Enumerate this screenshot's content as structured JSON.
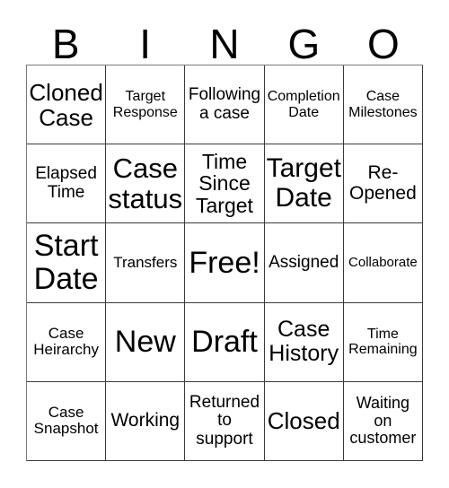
{
  "card": {
    "header_letters": [
      "B",
      "I",
      "N",
      "G",
      "O"
    ],
    "columns": 5,
    "rows": 5,
    "free_space_label": "Free!",
    "free_space_position": {
      "row": 3,
      "column": 3
    },
    "border_color": "#3a3a3a",
    "background_color": "#ffffff",
    "text_color": "#000000"
  },
  "cells": [
    {
      "id": "b1",
      "row": 1,
      "column": 1,
      "column_letter": "B",
      "text": "Cloned Case",
      "font_size": 27
    },
    {
      "id": "i1",
      "row": 1,
      "column": 2,
      "column_letter": "I",
      "text": "Target Response",
      "font_size": 16
    },
    {
      "id": "n1",
      "row": 1,
      "column": 3,
      "column_letter": "N",
      "text": "Following a case",
      "font_size": 20
    },
    {
      "id": "g1",
      "row": 1,
      "column": 4,
      "column_letter": "G",
      "text": "Completion Date",
      "font_size": 16
    },
    {
      "id": "o1",
      "row": 1,
      "column": 5,
      "column_letter": "O",
      "text": "Case Milestones",
      "font_size": 16
    },
    {
      "id": "b2",
      "row": 2,
      "column": 1,
      "column_letter": "B",
      "text": "Elapsed Time",
      "font_size": 19
    },
    {
      "id": "i2",
      "row": 2,
      "column": 2,
      "column_letter": "I",
      "text": "Case status",
      "font_size": 32
    },
    {
      "id": "n2",
      "row": 2,
      "column": 3,
      "column_letter": "N",
      "text": "Time Since Target",
      "font_size": 23
    },
    {
      "id": "g2",
      "row": 2,
      "column": 4,
      "column_letter": "G",
      "text": "Target Date",
      "font_size": 33
    },
    {
      "id": "o2",
      "row": 2,
      "column": 5,
      "column_letter": "O",
      "text": "Re- Opened",
      "font_size": 21
    },
    {
      "id": "b3",
      "row": 3,
      "column": 1,
      "column_letter": "B",
      "text": "Start Date",
      "font_size": 34
    },
    {
      "id": "i3",
      "row": 3,
      "column": 2,
      "column_letter": "I",
      "text": "Transfers",
      "font_size": 17
    },
    {
      "id": "n3",
      "row": 3,
      "column": 3,
      "column_letter": "N",
      "text": "Free!",
      "font_size": 34
    },
    {
      "id": "g3",
      "row": 3,
      "column": 4,
      "column_letter": "G",
      "text": "Assigned",
      "font_size": 19
    },
    {
      "id": "o3",
      "row": 3,
      "column": 5,
      "column_letter": "O",
      "text": "Collaborate",
      "font_size": 15
    },
    {
      "id": "b4",
      "row": 4,
      "column": 1,
      "column_letter": "B",
      "text": "Case Heirarchy",
      "font_size": 17
    },
    {
      "id": "i4",
      "row": 4,
      "column": 2,
      "column_letter": "I",
      "text": "New",
      "font_size": 34
    },
    {
      "id": "n4",
      "row": 4,
      "column": 3,
      "column_letter": "N",
      "text": "Draft",
      "font_size": 34
    },
    {
      "id": "g4",
      "row": 4,
      "column": 4,
      "column_letter": "G",
      "text": "Case History",
      "font_size": 25
    },
    {
      "id": "o4",
      "row": 4,
      "column": 5,
      "column_letter": "O",
      "text": "Time Remaining",
      "font_size": 16
    },
    {
      "id": "b5",
      "row": 5,
      "column": 1,
      "column_letter": "B",
      "text": "Case Snapshot",
      "font_size": 17
    },
    {
      "id": "i5",
      "row": 5,
      "column": 2,
      "column_letter": "I",
      "text": "Working",
      "font_size": 21
    },
    {
      "id": "n5",
      "row": 5,
      "column": 3,
      "column_letter": "N",
      "text": "Returned to support",
      "font_size": 19
    },
    {
      "id": "g5",
      "row": 5,
      "column": 4,
      "column_letter": "G",
      "text": "Closed",
      "font_size": 26
    },
    {
      "id": "o5",
      "row": 5,
      "column": 5,
      "column_letter": "O",
      "text": "Waiting on customer",
      "font_size": 18
    }
  ]
}
